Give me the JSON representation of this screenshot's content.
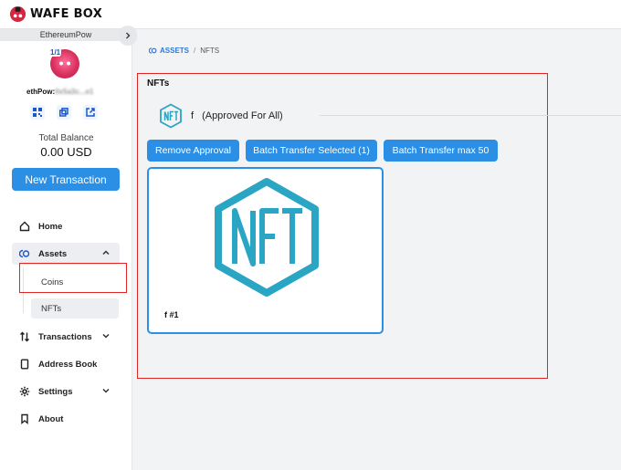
{
  "app": {
    "brand": "WAFE BOX"
  },
  "sidebar": {
    "network": "EthereumPow",
    "threshold": "1/1",
    "address_prefix": "ethPow:",
    "address_hidden": "0x5a3c...e1",
    "balance_label": "Total Balance",
    "balance_value": "0.00 USD",
    "new_tx_label": "New Transaction",
    "nav": {
      "home": "Home",
      "assets": "Assets",
      "coins": "Coins",
      "nfts": "NFTs",
      "transactions": "Transactions",
      "address_book": "Address Book",
      "settings": "Settings",
      "about": "About"
    }
  },
  "breadcrumb": {
    "assets": "ASSETS",
    "separator": "/",
    "current": "NFTS"
  },
  "main": {
    "title": "NFTs",
    "collection": {
      "name": "f",
      "status": "(Approved For All)"
    },
    "buttons": {
      "remove_approval": "Remove Approval",
      "batch_selected": "Batch Transfer Selected (1)",
      "batch_max": "Batch Transfer max 50"
    },
    "card": {
      "label": "f #1"
    }
  },
  "colors": {
    "accent": "#2b8fe5",
    "highlight_border": "#e02525",
    "nft_logo": "#2aa6c4"
  }
}
